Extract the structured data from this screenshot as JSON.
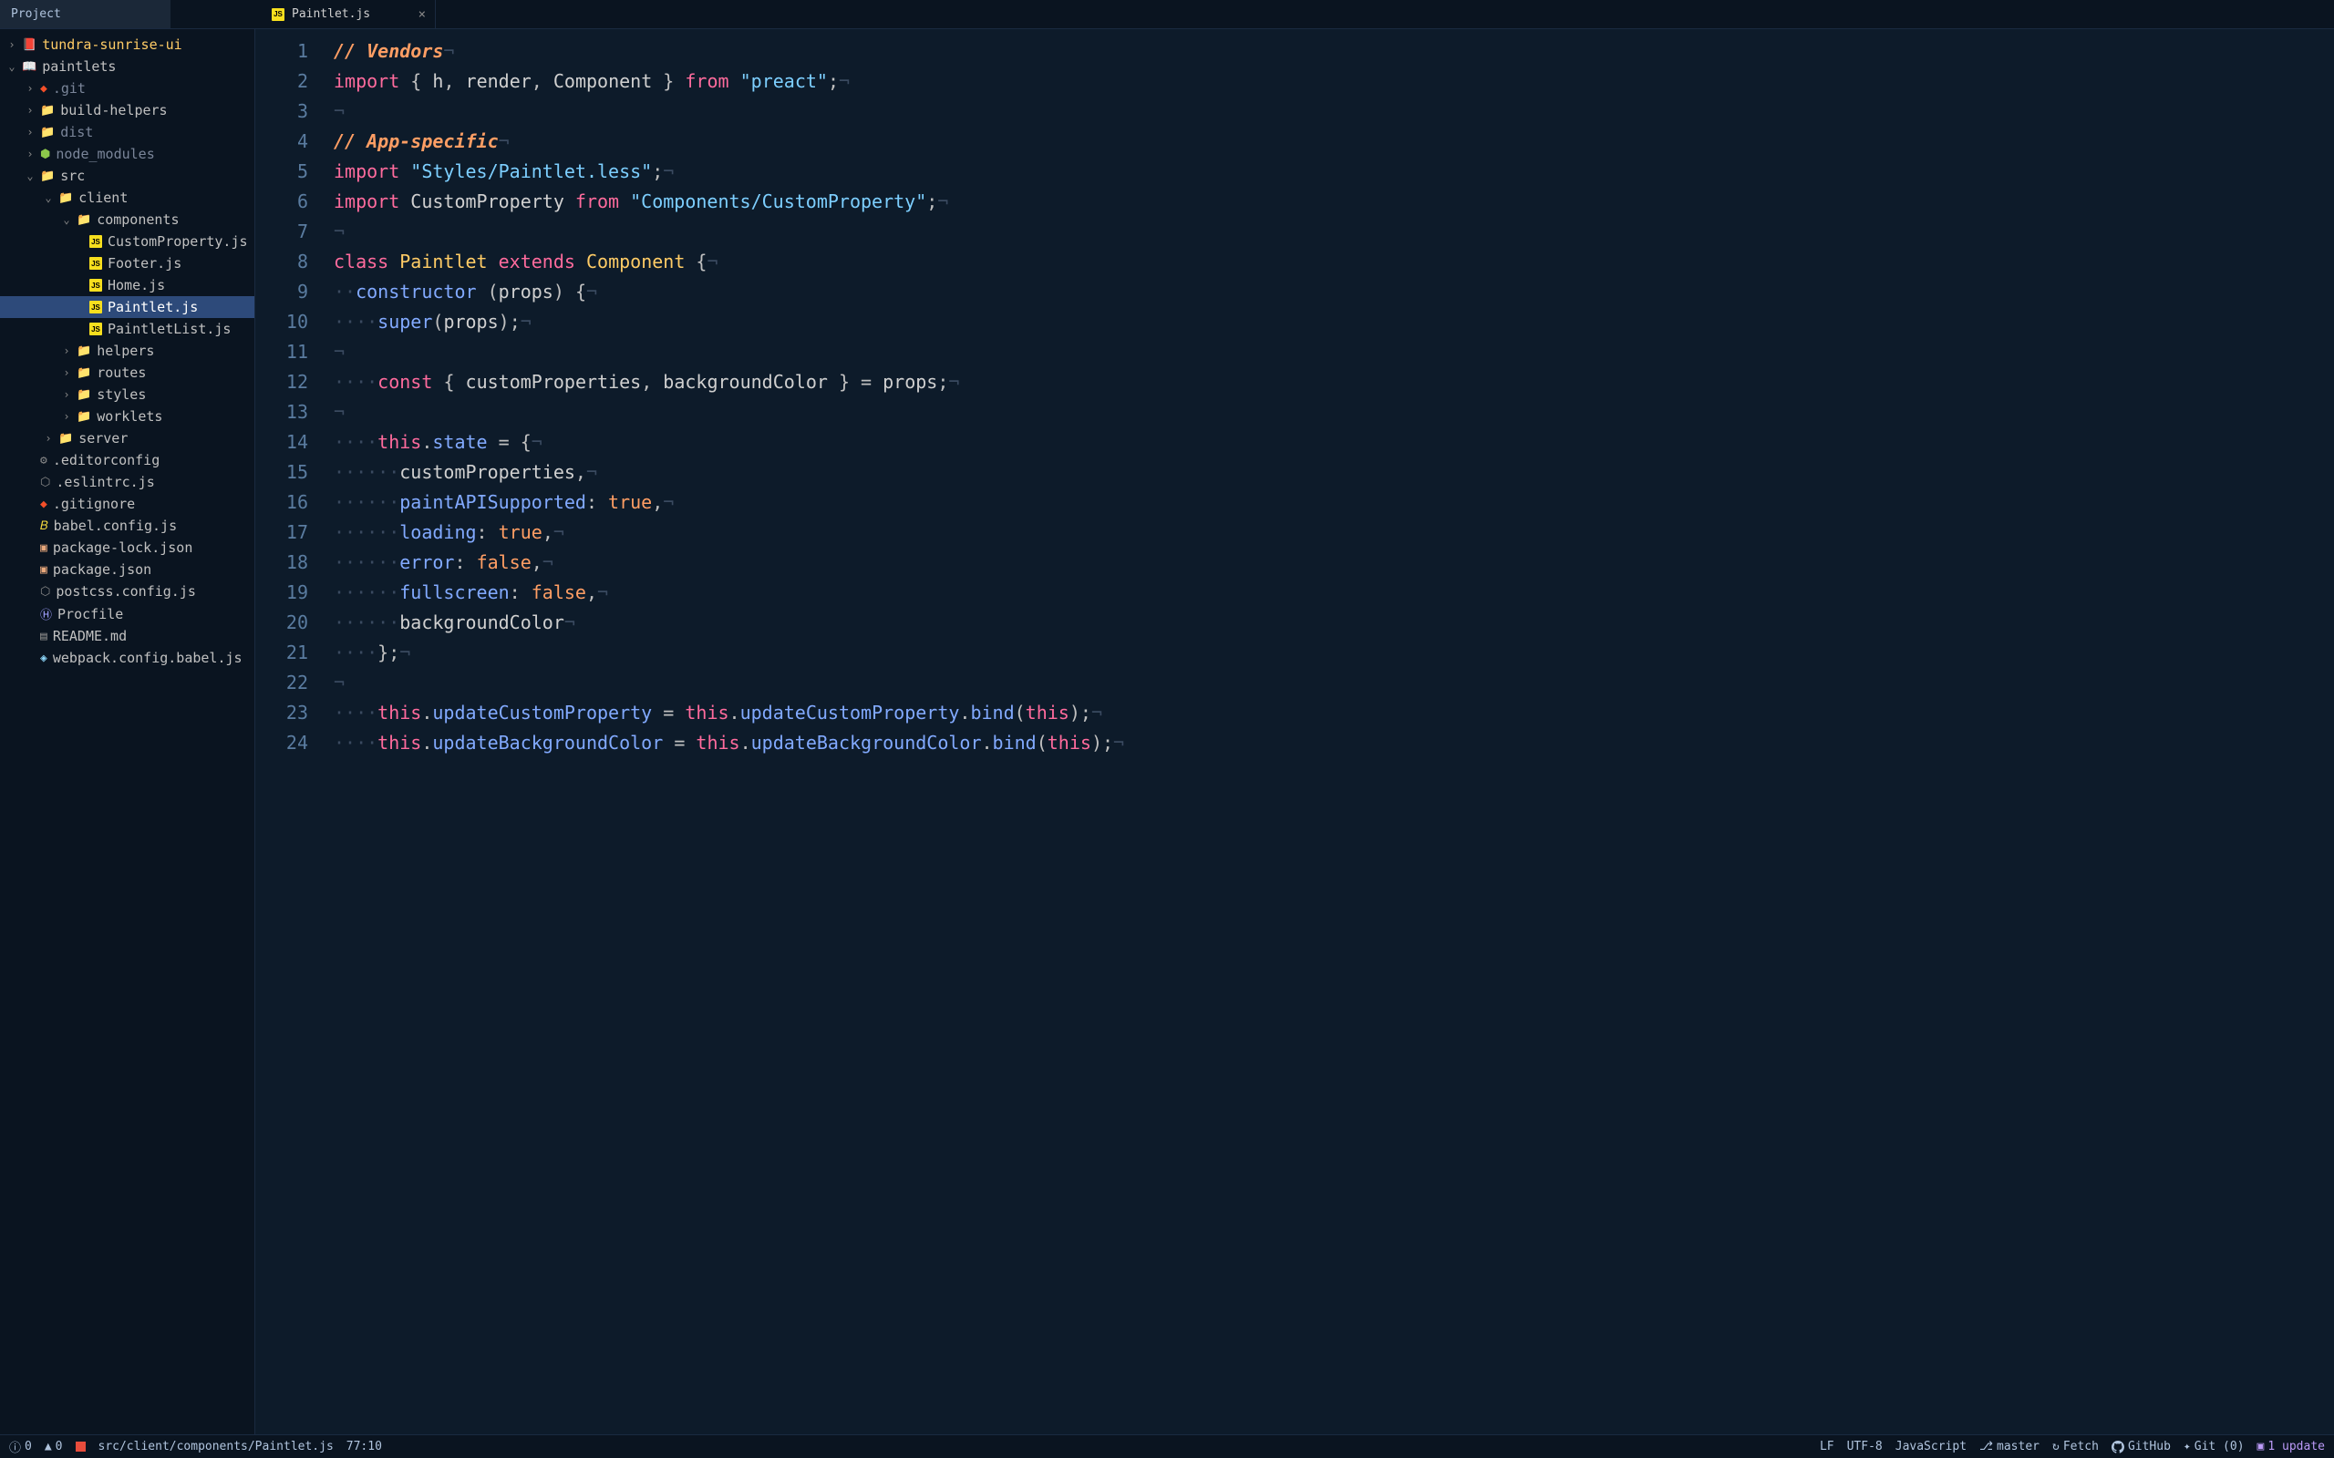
{
  "tabs": {
    "sidebarTab": "Project",
    "fileTab": "Paintlet.js"
  },
  "tree": {
    "root1": "tundra-sunrise-ui",
    "root2": "paintlets",
    "git": ".git",
    "buildHelpers": "build-helpers",
    "dist": "dist",
    "nodeModules": "node_modules",
    "src": "src",
    "client": "client",
    "components": "components",
    "customProperty": "CustomProperty.js",
    "footer": "Footer.js",
    "home": "Home.js",
    "paintlet": "Paintlet.js",
    "paintletList": "PaintletList.js",
    "helpers": "helpers",
    "routes": "routes",
    "styles": "styles",
    "worklets": "worklets",
    "server": "server",
    "editorconfig": ".editorconfig",
    "eslintrc": ".eslintrc.js",
    "gitignore": ".gitignore",
    "babelConfig": "babel.config.js",
    "packageLock": "package-lock.json",
    "packageJson": "package.json",
    "postcss": "postcss.config.js",
    "procfile": "Procfile",
    "readme": "README.md",
    "webpack": "webpack.config.babel.js"
  },
  "code": {
    "lines": [
      {
        "n": 1,
        "html": "<span class='comment'>// Vendors</span><span class='ws'>¬</span>"
      },
      {
        "n": 2,
        "html": "<span class='keyword'>import</span> <span class='punct'>{ </span>h<span class='punct'>, </span>render<span class='punct'>, </span>Component<span class='punct'> }</span> <span class='keyword'>from</span> <span class='string'>\"preact\"</span><span class='punct'>;</span><span class='ws'>¬</span>"
      },
      {
        "n": 3,
        "html": "<span class='ws'>¬</span>"
      },
      {
        "n": 4,
        "html": "<span class='comment'>// App-specific</span><span class='ws'>¬</span>"
      },
      {
        "n": 5,
        "html": "<span class='keyword'>import</span> <span class='string'>\"Styles/Paintlet.less\"</span><span class='punct'>;</span><span class='ws'>¬</span>"
      },
      {
        "n": 6,
        "html": "<span class='keyword'>import</span> CustomProperty <span class='keyword'>from</span> <span class='string'>\"Components/CustomProperty\"</span><span class='punct'>;</span><span class='ws'>¬</span>"
      },
      {
        "n": 7,
        "html": "<span class='ws'>¬</span>"
      },
      {
        "n": 8,
        "html": "<span class='keyword'>class</span> <span class='class-name'>Paintlet</span> <span class='keyword'>extends</span> <span class='class-name'>Component</span> <span class='punct'>{</span><span class='ws'>¬</span>"
      },
      {
        "n": 9,
        "html": "<span class='ws'>··</span><span class='func'>constructor</span> <span class='punct'>(</span>props<span class='punct'>)</span> <span class='punct'>{</span><span class='ws'>¬</span>"
      },
      {
        "n": 10,
        "html": "<span class='ws'>····</span><span class='func'>super</span><span class='punct'>(</span>props<span class='punct'>);</span><span class='ws'>¬</span>"
      },
      {
        "n": 11,
        "html": "<span class='ws'>¬</span>"
      },
      {
        "n": 12,
        "html": "<span class='ws'>····</span><span class='keyword'>const</span> <span class='punct'>{ </span>customProperties<span class='punct'>, </span>backgroundColor<span class='punct'> }</span> <span class='punct'>=</span> props<span class='punct'>;</span><span class='ws'>¬</span>"
      },
      {
        "n": 13,
        "html": "<span class='ws'>¬</span>"
      },
      {
        "n": 14,
        "html": "<span class='ws'>····</span><span class='this'>this</span><span class='punct'>.</span><span class='prop'>state</span> <span class='punct'>=</span> <span class='punct'>{</span><span class='ws'>¬</span>"
      },
      {
        "n": 15,
        "html": "<span class='ws'>······</span>customProperties<span class='punct'>,</span><span class='ws'>¬</span>"
      },
      {
        "n": 16,
        "html": "<span class='ws'>······</span><span class='prop'>paintAPISupported</span><span class='punct'>:</span> <span class='bool'>true</span><span class='punct'>,</span><span class='ws'>¬</span>"
      },
      {
        "n": 17,
        "html": "<span class='ws'>······</span><span class='prop'>loading</span><span class='punct'>:</span> <span class='bool'>true</span><span class='punct'>,</span><span class='ws'>¬</span>"
      },
      {
        "n": 18,
        "html": "<span class='ws'>······</span><span class='prop'>error</span><span class='punct'>:</span> <span class='bool'>false</span><span class='punct'>,</span><span class='ws'>¬</span>"
      },
      {
        "n": 19,
        "html": "<span class='ws'>······</span><span class='prop'>fullscreen</span><span class='punct'>:</span> <span class='bool'>false</span><span class='punct'>,</span><span class='ws'>¬</span>"
      },
      {
        "n": 20,
        "html": "<span class='ws'>······</span>backgroundColor<span class='ws'>¬</span>"
      },
      {
        "n": 21,
        "html": "<span class='ws'>····</span><span class='punct'>};</span><span class='ws'>¬</span>"
      },
      {
        "n": 22,
        "html": "<span class='ws'>¬</span>"
      },
      {
        "n": 23,
        "html": "<span class='ws'>····</span><span class='this'>this</span><span class='punct'>.</span><span class='prop'>updateCustomProperty</span> <span class='punct'>=</span> <span class='this'>this</span><span class='punct'>.</span><span class='prop'>updateCustomProperty</span><span class='punct'>.</span><span class='func'>bind</span><span class='punct'>(</span><span class='this'>this</span><span class='punct'>);</span><span class='ws'>¬</span>"
      },
      {
        "n": 24,
        "html": "<span class='ws'>····</span><span class='this'>this</span><span class='punct'>.</span><span class='prop'>updateBackgroundColor</span> <span class='punct'>=</span> <span class='this'>this</span><span class='punct'>.</span><span class='prop'>updateBackgroundColor</span><span class='punct'>.</span><span class='func'>bind</span><span class='punct'>(</span><span class='this'>this</span><span class='punct'>);</span><span class='ws'>¬</span>"
      }
    ]
  },
  "statusBar": {
    "errors": "0",
    "warnings": "0",
    "filePath": "src/client/components/Paintlet.js",
    "cursorPos": "77:10",
    "lineEnding": "LF",
    "encoding": "UTF-8",
    "language": "JavaScript",
    "branch": "master",
    "fetch": "Fetch",
    "github": "GitHub",
    "git": "Git (0)",
    "updates": "1 update"
  }
}
